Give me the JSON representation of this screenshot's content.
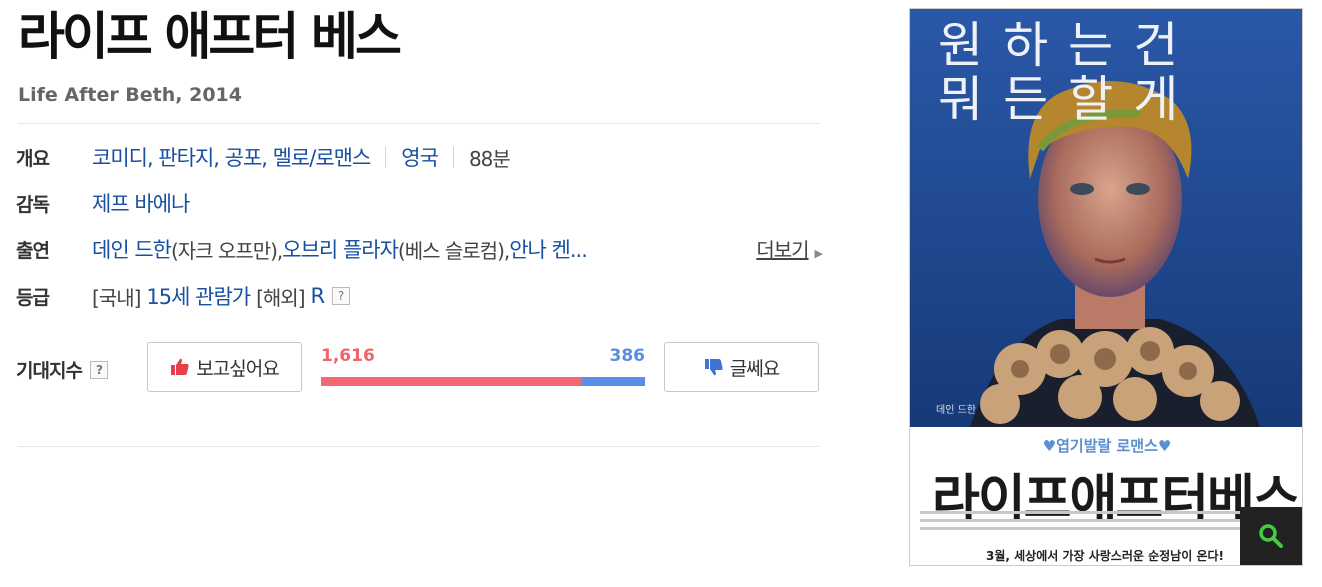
{
  "movie": {
    "title": "라이프 애프터 베스",
    "subtitle": "Life After Beth, 2014"
  },
  "overview": {
    "label": "개요",
    "genres": "코미디, 판타지, 공포, 멜로/로맨스",
    "country": "영국",
    "runtime": "88분"
  },
  "director": {
    "label": "감독",
    "name": "제프 바에나"
  },
  "cast": {
    "label": "출연",
    "actor1": "데인 드한",
    "role1": "(자크 오프만), ",
    "actor2": "오브리 플라자",
    "role2": "(베스 슬로컴), ",
    "actor3": "안나 켄...",
    "more_label": "더보기"
  },
  "rating": {
    "label": "등급",
    "domestic_prefix": "[국내]",
    "domestic_value": "15세 관람가",
    "foreign_prefix": "[해외]",
    "foreign_value": "R",
    "help": "?"
  },
  "expectation": {
    "label": "기대지수",
    "help": "?",
    "like_label": "보고싶어요",
    "dislike_label": "글쎄요",
    "like_count": "1,616",
    "dislike_count": "386",
    "like_fraction": 0.807
  },
  "poster": {
    "tagline_line1": "원하는건",
    "tagline_line2": "뭐든할게",
    "credit": "데인 드한",
    "sub_tagline": "♥엽기발랄 로맨스♥",
    "big_title": "라이프애프터베스",
    "release": "3월, 세상에서 가장 사랑스러운 순정남이 온다!"
  },
  "colors": {
    "link": "#1a50a3",
    "like": "#f26872",
    "dislike": "#5b8ee6"
  },
  "icons": {
    "like": "thumbs-up-icon",
    "dislike": "thumbs-down-icon",
    "more": "triangle-right-icon",
    "zoom": "magnifier-icon"
  }
}
